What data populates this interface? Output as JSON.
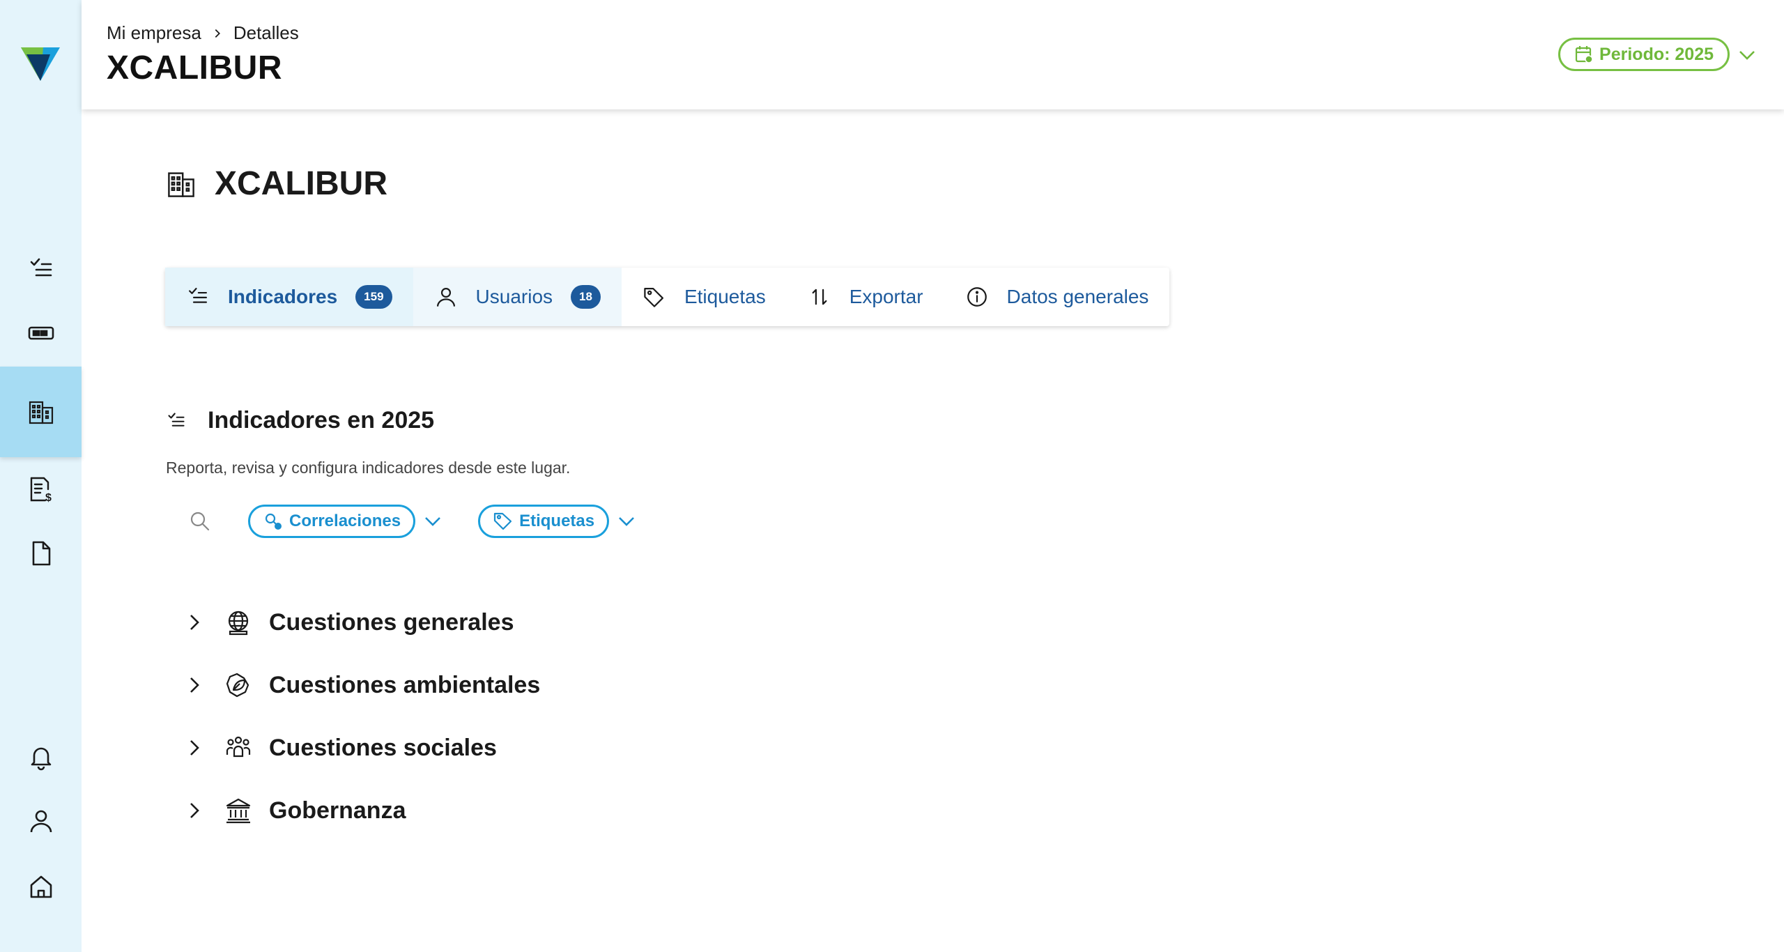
{
  "header": {
    "breadcrumb": [
      "Mi empresa",
      "Detalles"
    ],
    "title": "XCALIBUR",
    "period_label": "Periodo: 2025"
  },
  "sidebar": {
    "items": [
      {
        "icon": "checklist-icon"
      },
      {
        "icon": "card-icon"
      },
      {
        "icon": "building-icon",
        "active": true
      },
      {
        "icon": "invoice-icon"
      },
      {
        "icon": "document-icon"
      },
      {
        "icon": "bell-icon"
      },
      {
        "icon": "user-icon"
      },
      {
        "icon": "home-icon"
      }
    ]
  },
  "main": {
    "company_name": "XCALIBUR",
    "tabs": [
      {
        "label": "Indicadores",
        "badge": "159",
        "icon": "checklist-icon"
      },
      {
        "label": "Usuarios",
        "badge": "18",
        "icon": "user-icon"
      },
      {
        "label": "Etiquetas",
        "icon": "tag-icon"
      },
      {
        "label": "Exportar",
        "icon": "sort-arrows-icon"
      },
      {
        "label": "Datos generales",
        "icon": "info-icon"
      }
    ],
    "section_title": "Indicadores en 2025",
    "section_subtitle": "Reporta, revisa y configura indicadores desde este lugar.",
    "filters": {
      "correlations": "Correlaciones",
      "tags": "Etiquetas"
    },
    "categories": [
      {
        "label": "Cuestiones generales",
        "icon": "globe-icon"
      },
      {
        "label": "Cuestiones ambientales",
        "icon": "leaf-icon"
      },
      {
        "label": "Cuestiones sociales",
        "icon": "people-icon"
      },
      {
        "label": "Gobernanza",
        "icon": "institution-icon"
      }
    ]
  },
  "colors": {
    "sidebar_bg": "#e4f4fb",
    "sidebar_active": "#a6dcf3",
    "primary_blue": "#1d5a9c",
    "chip_blue": "#1aa0dc",
    "period_green": "#77c043"
  }
}
